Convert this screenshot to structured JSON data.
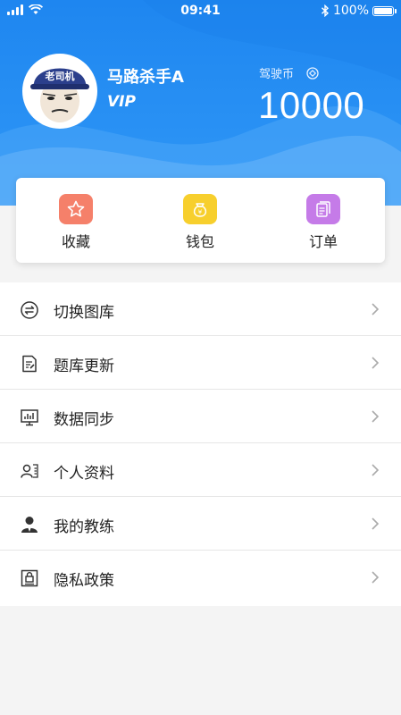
{
  "status_bar": {
    "time": "09:41",
    "battery": "100%"
  },
  "profile": {
    "username": "马路杀手A",
    "vip_label": "VIP",
    "coin_label": "驾驶币",
    "coin_value": "10000",
    "avatar_hat_text": "老司机"
  },
  "quick_actions": [
    {
      "label": "收藏",
      "icon": "star-icon",
      "color": "#f5806a"
    },
    {
      "label": "钱包",
      "icon": "wallet-icon",
      "color": "#f7cf2d"
    },
    {
      "label": "订单",
      "icon": "order-icon",
      "color": "#c57be8"
    }
  ],
  "menu": [
    {
      "label": "切换图库",
      "icon": "switch-icon"
    },
    {
      "label": "题库更新",
      "icon": "document-edit-icon"
    },
    {
      "label": "数据同步",
      "icon": "monitor-chart-icon"
    },
    {
      "label": "个人资料",
      "icon": "profile-card-icon"
    },
    {
      "label": "我的教练",
      "icon": "coach-icon"
    },
    {
      "label": "隐私政策",
      "icon": "privacy-lock-icon"
    }
  ],
  "colors": {
    "header_blue": "#1e86f0",
    "background": "#f4f4f4"
  }
}
